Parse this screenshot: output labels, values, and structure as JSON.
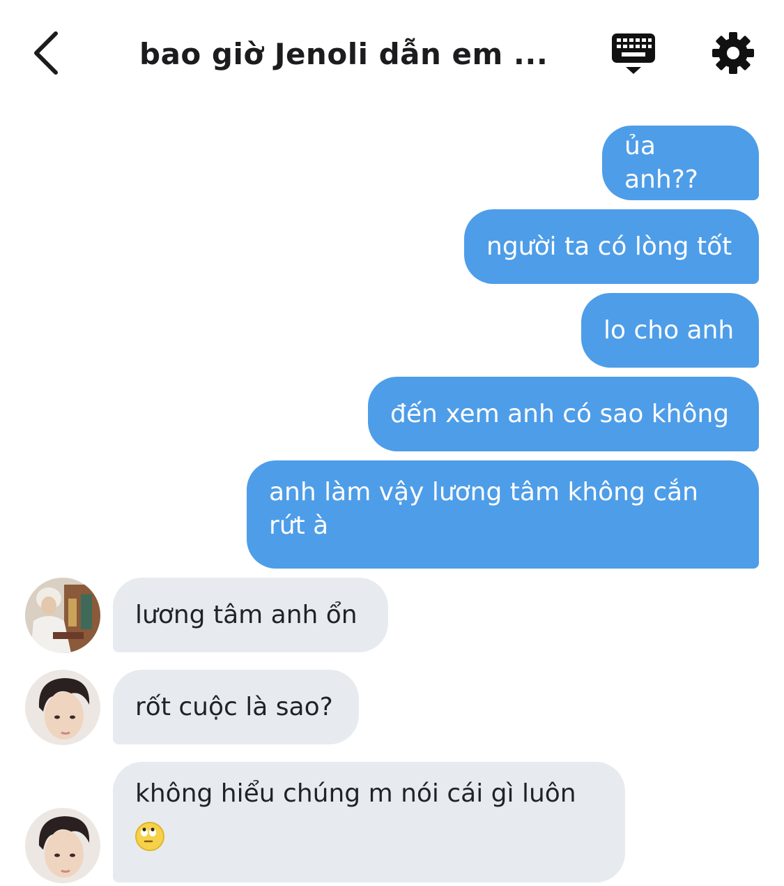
{
  "header": {
    "title": "bao giờ Jenoli dẫn em ...",
    "back_icon": "chevron-left-icon",
    "keyboard_icon": "keyboard-icon",
    "settings_icon": "gear-icon"
  },
  "messages": {
    "out": [
      "ủa anh??",
      "người ta có lòng tốt",
      "lo cho anh",
      "đến xem anh có sao không",
      "anh làm vậy lương tâm không cắn\nrứt à"
    ],
    "in": [
      "lương tâm anh ổn",
      "rốt cuộc là sao?",
      "không hiểu chúng m nói cái gì luôn"
    ],
    "in_3_emoji": "eye-roll-emoji"
  },
  "colors": {
    "outgoing_bubble": "#4e9de8",
    "incoming_bubble": "#e7ebf0",
    "text_dark": "#1c1c1e"
  }
}
